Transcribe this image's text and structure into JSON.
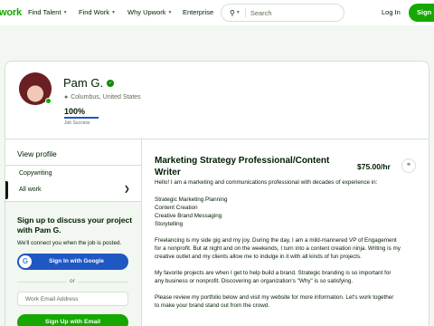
{
  "nav": {
    "logo": "work",
    "items": [
      "Find Talent",
      "Find Work",
      "Why Upwork",
      "Enterprise"
    ],
    "search_placeholder": "Search",
    "login": "Log In",
    "signup": "Sign"
  },
  "profile": {
    "name": "Pam G.",
    "location": "Columbus, United States",
    "job_success_pct": "100%",
    "job_success_value": 1.0,
    "job_success_label": "Job Success"
  },
  "sidebar": {
    "view_profile": "View profile",
    "items": [
      "Copywriting",
      "All work"
    ],
    "active_index": 1
  },
  "signup_box": {
    "title": "Sign up to discuss your project with Pam G.",
    "subtitle": "We'll connect you when the job is posted.",
    "google_label": "Sign In with Google",
    "or": "or",
    "email_placeholder": "Work Email Address",
    "email_button": "Sign Up with Email"
  },
  "details": {
    "title": "Marketing Strategy Professional/Content Writer",
    "rate": "$75.00/hr",
    "paragraphs": [
      "Hello! I am a marketing and communications professional with decades of experience in:",
      "Strategic Marketing Planning",
      "Content Creation",
      "Creative Brand Messaging",
      "Storytelling",
      "Freelancing is my side gig and my joy. During the day, I am a mild-mannered VP of Engagement",
      "for a nonprofit. But at night and on the weekends, I turn into a content creation ninja. Writing is my",
      "creative outlet and my clients allow me to indulge in it with all kinds of fun projects.",
      "My favorite projects are when I get to help build a brand. Strategic branding is so important for",
      "any business or nonprofit. Discovering an organization's \"Why\" is so satisfying.",
      "Please review my portfolio below and visit my website for more information. Let's work together",
      "to make your brand stand out from the crowd."
    ]
  },
  "colors": {
    "brand_green": "#14a800",
    "link_blue": "#1f57c3",
    "text": "#001e00",
    "muted": "#5e6d55",
    "border": "#d5e0d5"
  },
  "icons": {
    "search": "search-icon",
    "location": "location-pin-icon",
    "verified": "verified-badge-icon",
    "chevron": "chevron-right-icon",
    "link": "link-icon",
    "google": "google-icon"
  }
}
